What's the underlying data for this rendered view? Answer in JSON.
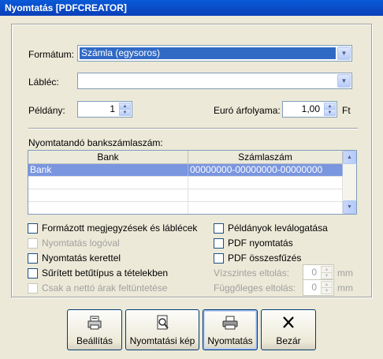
{
  "window": {
    "title": "Nyomtatás [PDFCREATOR]"
  },
  "format": {
    "label": "Formátum:",
    "value": "Számla (egysoros)"
  },
  "footer": {
    "label": "Lábléc:",
    "value": ""
  },
  "copies": {
    "label": "Példány:",
    "value": "1"
  },
  "euro": {
    "label": "Euró árfolyama:",
    "value": "1,00",
    "unit": "Ft"
  },
  "bank_accounts": {
    "label": "Nyomtatandó bankszámlaszám:",
    "columns": [
      "Bank",
      "Számlaszám"
    ],
    "rows": [
      {
        "bank": "Bank",
        "account": "00000000-00000000-00000000"
      }
    ]
  },
  "options": {
    "formatted_notes": "Formázott megjegyzések és láblécek",
    "print_logo": "Nyomtatás logóval",
    "print_frame": "Nyomtatás kerettel",
    "condensed_items": "Sűrített betűtípus a tételekben",
    "net_prices_only": "Csak a nettó árak feltüntetése",
    "collate_copies": "Példányok leválogatása",
    "pdf_print": "PDF nyomtatás",
    "pdf_merge": "PDF összesfűzés"
  },
  "offsets": {
    "horizontal_label": "Vízszintes eltolás:",
    "horizontal_value": "0",
    "vertical_label": "Függőleges eltolás:",
    "vertical_value": "0",
    "unit": "mm"
  },
  "buttons": {
    "settings": "Beállítás",
    "preview": "Nyomtatási kép",
    "print": "Nyomtatás",
    "close": "Bezár"
  },
  "icons": {
    "settings": "printer-settings-icon",
    "preview": "print-preview-icon",
    "print": "printer-icon",
    "close": "close-icon"
  },
  "colors": {
    "selection": "#316ac5",
    "row_selection": "#7a96df",
    "titlebar": "#0a4fc8"
  }
}
